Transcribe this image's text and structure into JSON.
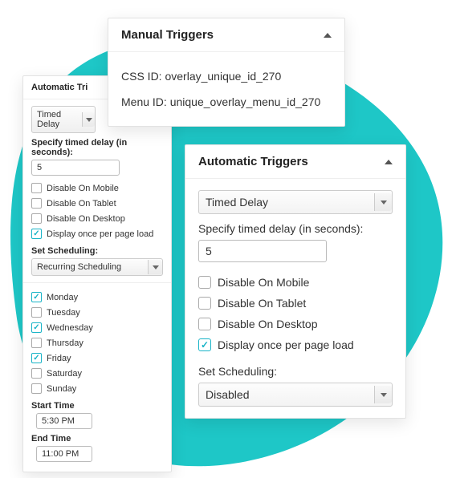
{
  "manual": {
    "title": "Manual Triggers",
    "css_id_label": "CSS ID:",
    "css_id_value": "overlay_unique_id_270",
    "menu_id_label": "Menu ID:",
    "menu_id_value": "unique_overlay_menu_id_270"
  },
  "auto_front": {
    "title": "Automatic Triggers",
    "trigger_select": "Timed Delay",
    "delay_label": "Specify timed delay (in seconds):",
    "delay_value": "5",
    "opts": {
      "mobile": "Disable On Mobile",
      "tablet": "Disable On Tablet",
      "desktop": "Disable On Desktop",
      "once": "Display once per page load"
    },
    "scheduling_label": "Set Scheduling:",
    "scheduling_value": "Disabled"
  },
  "auto_back": {
    "title": "Automatic Tri",
    "trigger_select": "Timed Delay",
    "delay_label": "Specify timed delay (in seconds):",
    "delay_value": "5",
    "opts": {
      "mobile": "Disable On Mobile",
      "tablet": "Disable On Tablet",
      "desktop": "Disable On Desktop",
      "once": "Display once per page load"
    },
    "scheduling_label": "Set Scheduling:",
    "scheduling_value": "Recurring Scheduling",
    "days": {
      "mon": "Monday",
      "tue": "Tuesday",
      "wed": "Wednesday",
      "thu": "Thursday",
      "fri": "Friday",
      "sat": "Saturday",
      "sun": "Sunday"
    },
    "start_label": "Start Time",
    "start_value": "5:30 PM",
    "end_label": "End Time",
    "end_value": "11:00 PM"
  }
}
